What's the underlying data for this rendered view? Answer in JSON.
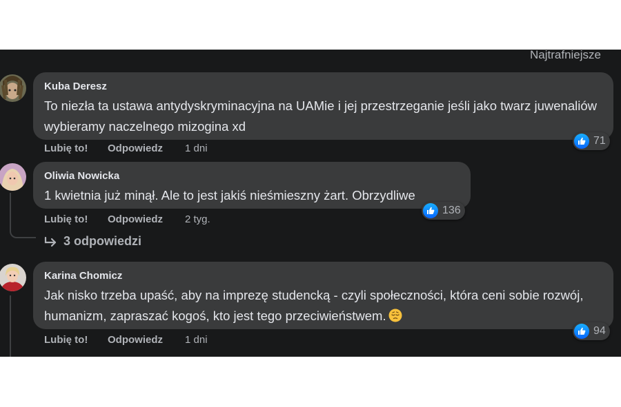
{
  "sort_label": "Najtrafniejsze",
  "colors": {
    "background": "#18191a",
    "bubble": "#3a3b3c",
    "text": "#e4e6eb",
    "muted": "#b0b3b8",
    "like": "#0866ff"
  },
  "like_label": "Lubię to!",
  "reply_label": "Odpowiedz",
  "comments": [
    {
      "author": "Kuba Deresz",
      "text": "To niezła ta ustawa antydyskryminacyjna na UAMie i jej przestrzeganie jeśli jako twarz juwenaliów wybieramy naczelnego mizogina xd",
      "time": "1 dni",
      "reactions": "71",
      "reaction_icon": "like-icon"
    },
    {
      "author": "Oliwia Nowicka",
      "text": "1 kwietnia już minął. Ale to jest jakiś nieśmieszny żart. Obrzydliwe",
      "time": "2 tyg.",
      "reactions": "136",
      "reaction_icon": "like-icon",
      "replies": "3 odpowiedzi"
    },
    {
      "author": "Karina Chomicz",
      "text": "Jak nisko trzeba upaść, aby na imprezę studencką - czyli społeczności, która ceni sobie rozwój, humanizm, zapraszać kogoś, kto jest tego przeciwieństwem.",
      "emoji": "pensive-face-icon",
      "time": "1 dni",
      "reactions": "94",
      "reaction_icon": "like-icon"
    }
  ]
}
